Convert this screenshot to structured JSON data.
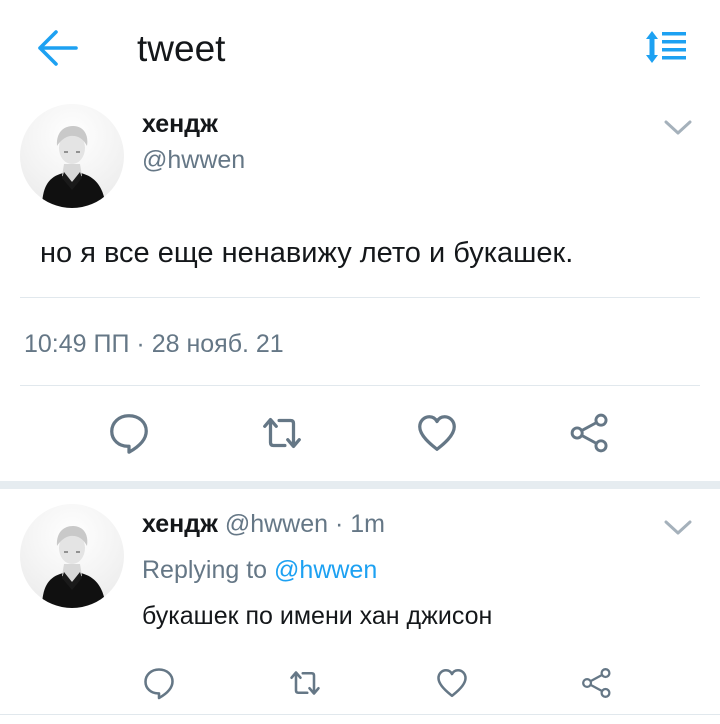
{
  "header": {
    "title": "tweet",
    "back_icon": "arrow-left-icon",
    "sort_icon": "sort-list-icon",
    "accent_color": "#1da1f2"
  },
  "main_tweet": {
    "display_name": "хендж",
    "handle": "@hwwen",
    "text": "но я все еще ненавижу лето и букашек.",
    "time": "10:49 ПП",
    "separator": "·",
    "date": "28 нояб. 21",
    "actions": [
      "reply-icon",
      "retweet-icon",
      "like-icon",
      "share-icon"
    ]
  },
  "reply_tweet": {
    "display_name": "хендж",
    "handle": "@hwwen",
    "separator": "·",
    "time": "1m",
    "replying_label": "Replying to",
    "replying_to": "@hwwen",
    "text": "букашек по имени хан джисон",
    "actions": [
      "reply-icon",
      "retweet-icon",
      "like-icon",
      "share-icon"
    ]
  },
  "colors": {
    "text_primary": "#14171a",
    "text_secondary": "#657786",
    "divider": "#e1e8ed",
    "accent": "#1da1f2"
  }
}
